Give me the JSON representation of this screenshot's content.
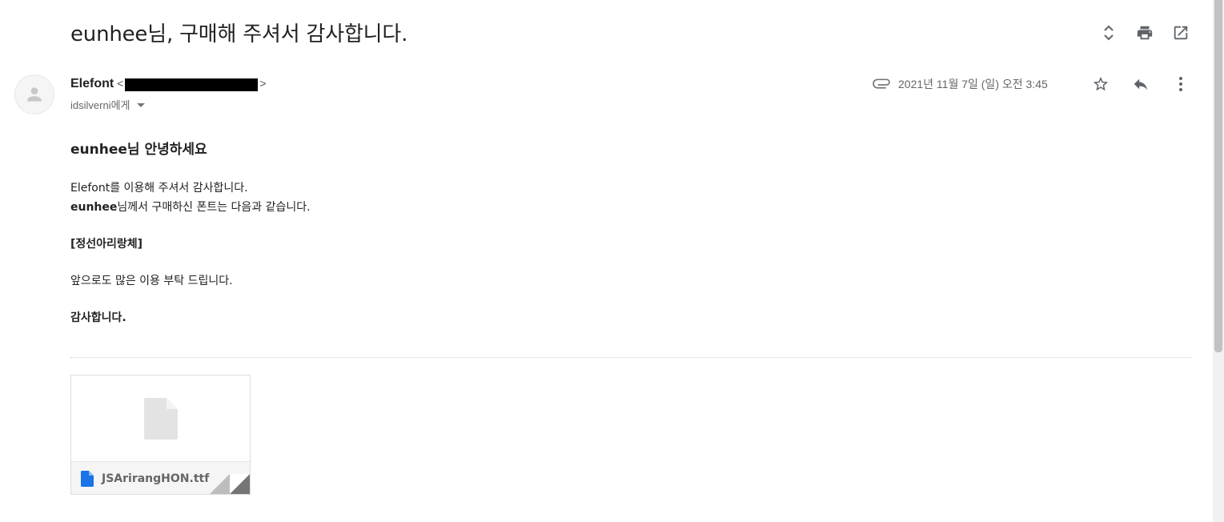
{
  "subject": "eunhee님, 구매해 주셔서 감사합니다.",
  "top_actions": {
    "expand_icon": "unfold-icon",
    "print_icon": "print-icon",
    "open_new_window_icon": "open-in-new-icon"
  },
  "sender": {
    "name": "Elefont",
    "email_open": "<",
    "email_close": ">",
    "recipient": "idsilverni에게"
  },
  "meta": {
    "date": "2021년 11월 7일 (일) 오전 3:45"
  },
  "body": {
    "greeting": "eunhee님 안녕하세요",
    "line1": "Elefont를 이용해 주셔서 감사합니다.",
    "line2_bold": "eunhee",
    "line2_rest": "님께서 구매하신 폰트는 다음과 같습니다.",
    "font_name": "[정선아리랑체]",
    "line3": "앞으로도 많은 이용 부탁 드립니다.",
    "closing": "감사합니다."
  },
  "attachment": {
    "filename": "JSArirangHON.ttf"
  },
  "colors": {
    "icon_gray": "#5f6368",
    "file_blue": "#1a73e8"
  }
}
